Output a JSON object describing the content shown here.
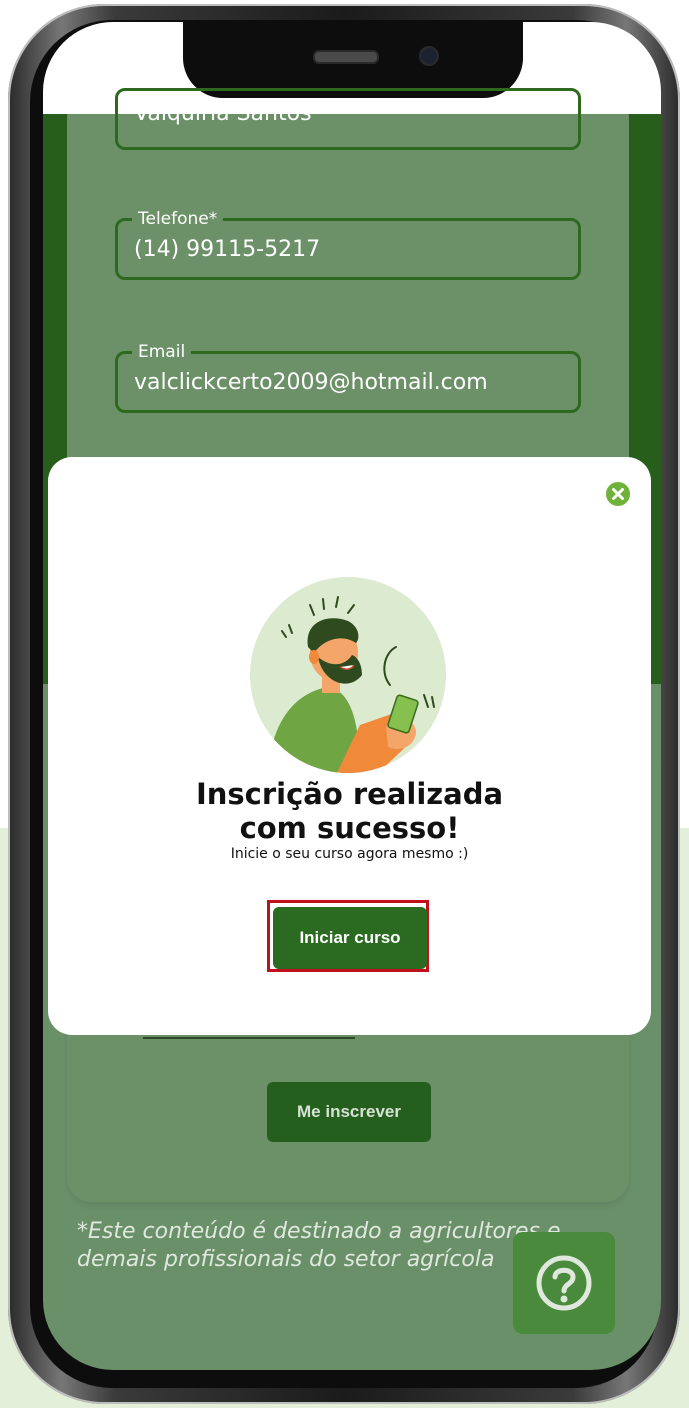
{
  "form": {
    "name_value": "Valquiria Santos",
    "phone_label": "Telefone*",
    "phone_value": "(14) 99115-5217",
    "email_label": "Email",
    "email_value": "valclickcerto2009@hotmail.com",
    "submit_label": "Me inscrever"
  },
  "disclaimer": "*Este conteúdo é destinado a agricultores e demais profissionais do setor agrícola",
  "help": {
    "icon": "question-icon"
  },
  "modal": {
    "close_icon": "close-circle-icon",
    "title_line1": "Inscrição realizada",
    "title_line2": "com sucesso!",
    "subtitle": "Inicie o seu curso agora mesmo :)",
    "button_label": "Iniciar curso"
  },
  "colors": {
    "brand_green": "#2a6b21",
    "overlay_green": "#6c9169",
    "accent_green": "#6fb23a",
    "highlight_red": "#c0101e"
  }
}
